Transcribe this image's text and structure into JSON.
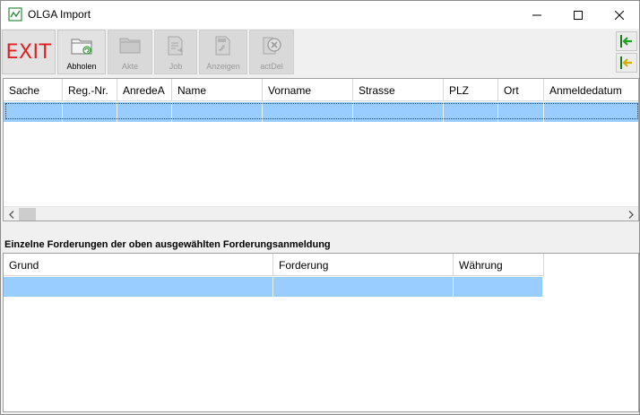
{
  "window": {
    "title": "OLGA Import",
    "app_icon": "chart-icon",
    "controls": [
      "minimize-icon",
      "maximize-icon",
      "close-icon"
    ]
  },
  "toolbar": {
    "exit_label": "EXIT",
    "buttons": [
      {
        "label": "Abholen",
        "icon": "folder-refresh-icon",
        "enabled": true
      },
      {
        "label": "Akte",
        "icon": "folder-icon",
        "enabled": false
      },
      {
        "label": "Job",
        "icon": "document-arrow-icon",
        "enabled": false
      },
      {
        "label": "Anzeigen",
        "icon": "pdf-icon",
        "enabled": false
      },
      {
        "label": "actDel",
        "icon": "delete-circle-icon",
        "enabled": false
      }
    ],
    "side_buttons": [
      "import-left-icon",
      "export-left-icon"
    ]
  },
  "upper_grid": {
    "columns": [
      "Sache",
      "Reg.-Nr.",
      "AnredeA",
      "Name",
      "Vorname",
      "Strasse",
      "PLZ",
      "Ort",
      "Anmeldedatum"
    ],
    "selected_row_color": "#99ccff"
  },
  "lower_section": {
    "caption": "Einzelne Forderungen der oben ausgewählten Forderungsanmeldung",
    "columns": [
      "Grund",
      "Forderung",
      "Währung"
    ],
    "selected_row_color": "#99ccff"
  }
}
